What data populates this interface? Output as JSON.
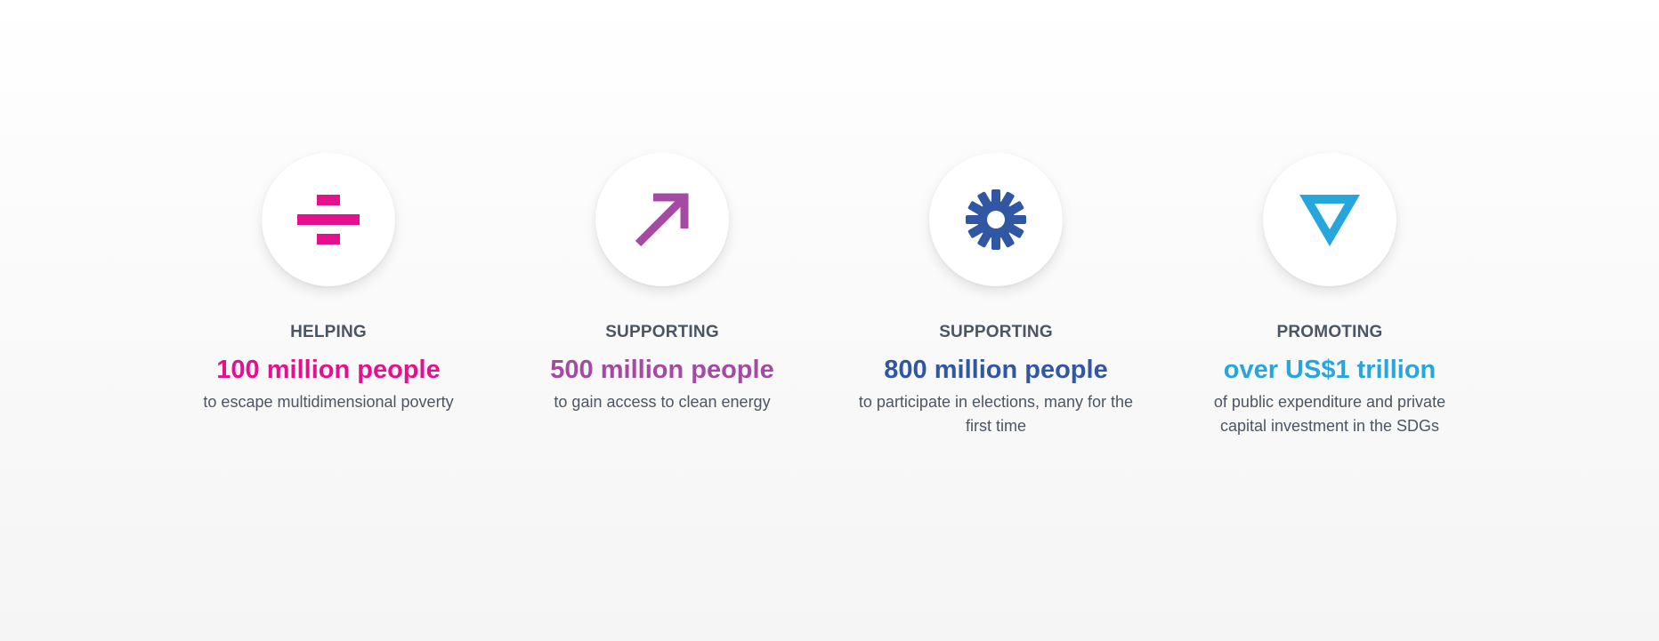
{
  "stats": [
    {
      "verb": "HELPING",
      "figure": "100 million people",
      "description": "to escape multidimensional poverty",
      "icon": "divide-icon",
      "color": "#e5108e"
    },
    {
      "verb": "SUPPORTING",
      "figure": "500 million people",
      "description": "to gain access to clean energy",
      "icon": "arrow-up-right-icon",
      "color": "#a54aa2"
    },
    {
      "verb": "SUPPORTING",
      "figure": "800 million people",
      "description": "to participate in elections, many for the first time",
      "icon": "asterisk-icon",
      "color": "#3157a4"
    },
    {
      "verb": "PROMOTING",
      "figure": "over US$1 trillion",
      "description": "of public expenditure and private capital investment in the SDGs",
      "icon": "triangle-down-icon",
      "color": "#27a6de"
    }
  ]
}
